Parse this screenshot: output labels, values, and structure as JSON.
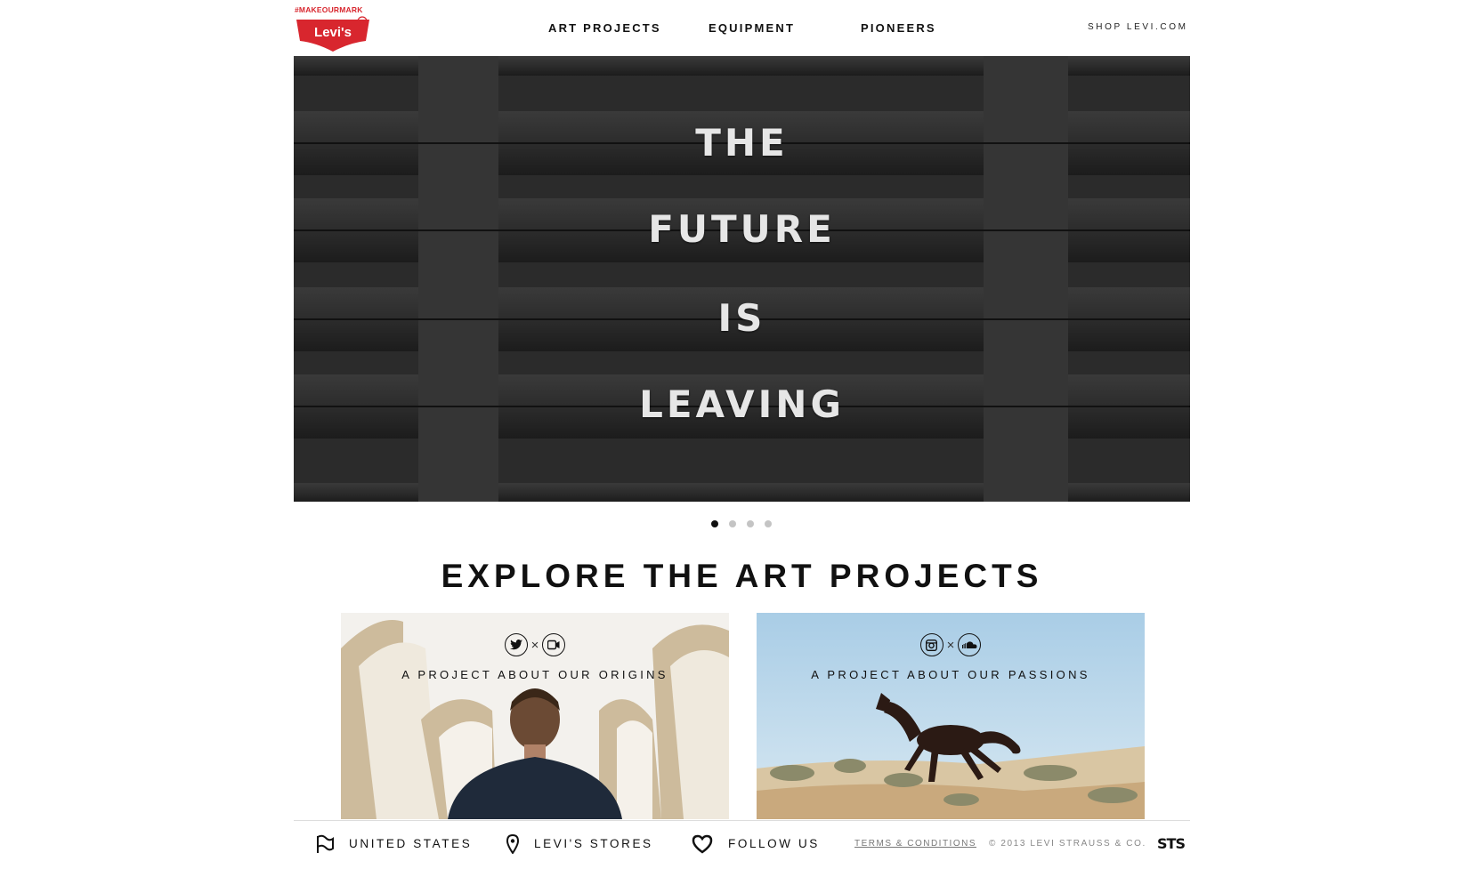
{
  "header": {
    "hashtag": "#MAKEOURMARK",
    "logo_text": "Levi's",
    "nav": [
      "ART PROJECTS",
      "EQUIPMENT",
      "PIONEERS"
    ],
    "shop_link": "SHOP LEVI.COM"
  },
  "hero": {
    "words": [
      "THE",
      "FUTURE",
      "IS",
      "LEAVING"
    ],
    "slides": 4,
    "active_slide": 1
  },
  "section": {
    "title": "EXPLORE THE ART PROJECTS"
  },
  "cards": [
    {
      "caption": "A PROJECT ABOUT OUR ORIGINS",
      "icons": [
        "twitter-icon",
        "video-icon"
      ],
      "times": "×"
    },
    {
      "caption": "A PROJECT ABOUT OUR PASSIONS",
      "icons": [
        "instagram-icon",
        "soundcloud-icon"
      ],
      "times": "×"
    }
  ],
  "footer": {
    "country": "UNITED STATES",
    "stores": "LEVI'S STORES",
    "follow": "FOLLOW US",
    "terms": "TERMS & CONDITIONS",
    "copyright": "© 2013 LEVI STRAUSS & CO.",
    "agency": "STS"
  },
  "colors": {
    "brand_red": "#d8262e",
    "hero_bg": "#2a2a2a"
  }
}
